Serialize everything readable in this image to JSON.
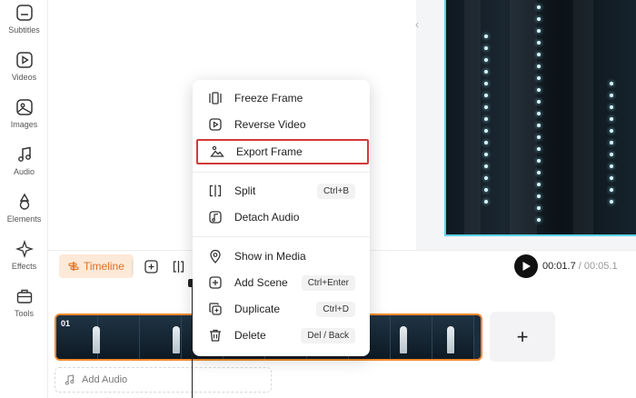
{
  "sidebar": {
    "items": [
      {
        "label": "Subtitles",
        "icon": "subtitles-icon"
      },
      {
        "label": "Videos",
        "icon": "video-icon"
      },
      {
        "label": "Images",
        "icon": "image-icon"
      },
      {
        "label": "Audio",
        "icon": "music-note-icon"
      },
      {
        "label": "Elements",
        "icon": "shapes-icon"
      },
      {
        "label": "Effects",
        "icon": "sparkle-icon"
      },
      {
        "label": "Tools",
        "icon": "toolbox-icon"
      }
    ]
  },
  "timeline": {
    "tab_label": "Timeline",
    "current_time": "00:01.7",
    "total_time": "/ 00:05.1",
    "clip_number": "01",
    "add_audio_label": "Add Audio",
    "add_clip_label": "+"
  },
  "context_menu": {
    "items": [
      {
        "label": "Freeze Frame",
        "shortcut": "",
        "icon": "freeze-frame-icon"
      },
      {
        "label": "Reverse Video",
        "shortcut": "",
        "icon": "reverse-icon"
      },
      {
        "label": "Export Frame",
        "shortcut": "",
        "icon": "image-export-icon",
        "highlighted": true
      },
      {
        "label": "Split",
        "shortcut": "Ctrl+B",
        "icon": "split-icon"
      },
      {
        "label": "Detach Audio",
        "shortcut": "",
        "icon": "detach-audio-icon"
      },
      {
        "label": "Show in Media",
        "shortcut": "",
        "icon": "location-pin-icon"
      },
      {
        "label": "Add Scene",
        "shortcut": "Ctrl+Enter",
        "icon": "add-scene-icon"
      },
      {
        "label": "Duplicate",
        "shortcut": "Ctrl+D",
        "icon": "duplicate-icon"
      },
      {
        "label": "Delete",
        "shortcut": "Del / Back",
        "icon": "trash-icon"
      }
    ]
  },
  "colors": {
    "accent": "#f08a2e",
    "highlight_border": "#d33a3a",
    "preview_border": "#59d4e8"
  }
}
